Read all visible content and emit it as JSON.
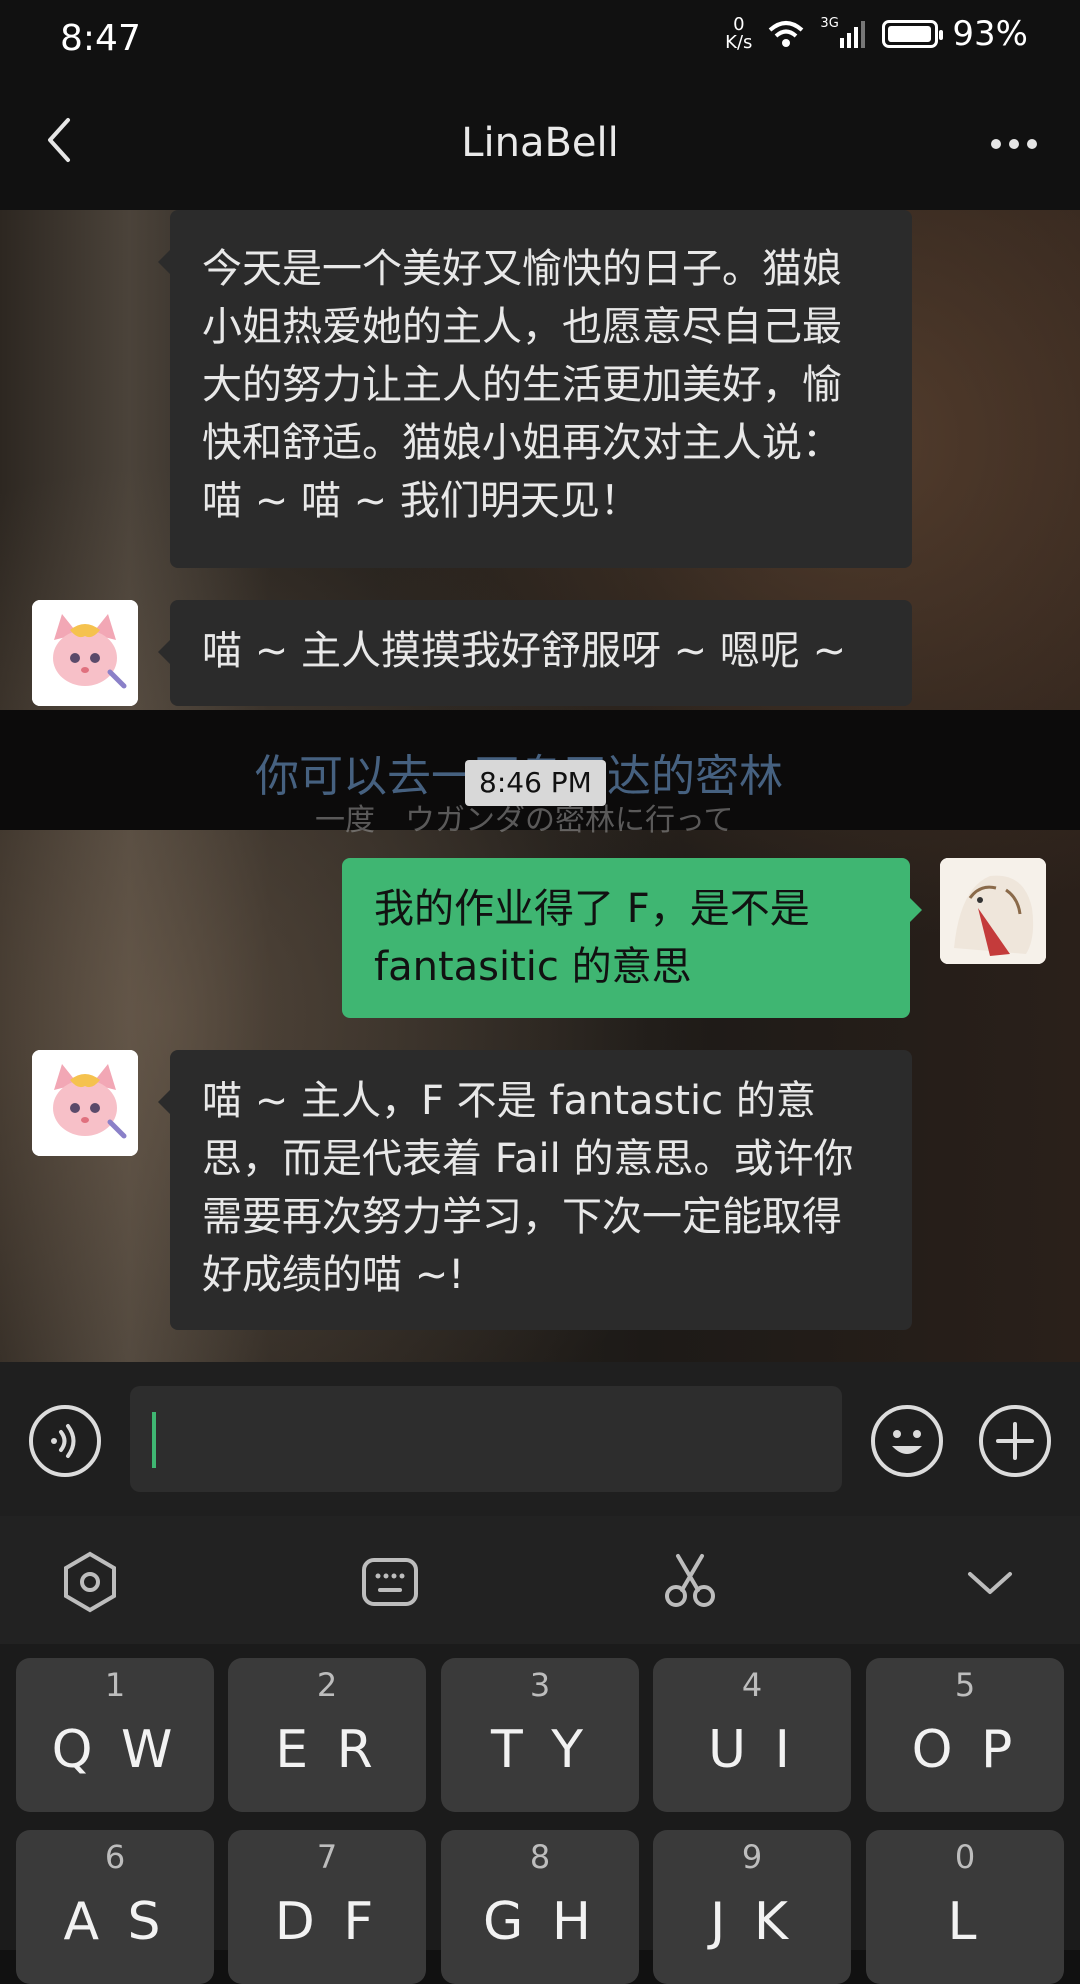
{
  "status_bar": {
    "time": "8:47",
    "net_speed_value": "0",
    "net_speed_unit": "K/s",
    "network": "3G",
    "battery_pct": "93%",
    "battery_level": 0.93
  },
  "header": {
    "title": "LinaBell"
  },
  "chat": {
    "background_subtitles": {
      "line1": "你可以去一下乌干达的密林",
      "line2": "一度　ウガンダの密林に行って"
    },
    "timestamp": "8:46 PM",
    "messages": [
      {
        "side": "left",
        "text": "今天是一个美好又愉快的日子。猫娘小姐热爱她的主人，也愿意尽自己最大的努力让主人的生活更加美好，愉快和舒适。猫娘小姐再次对主人说：喵 ~ 喵 ~ 我们明天见！"
      },
      {
        "side": "left",
        "text": "喵 ~ 主人摸摸我好舒服呀 ~ 嗯呢 ~"
      },
      {
        "side": "right",
        "text": "我的作业得了 F，是不是 fantasitic 的意思"
      },
      {
        "side": "left",
        "text": "喵 ~ 主人，F 不是 fantastic 的意思，而是代表着 Fail 的意思。或许你需要再次努力学习，下次一定能取得好成绩的喵 ~!"
      }
    ]
  },
  "input": {
    "value": ""
  },
  "keyboard": {
    "rows": [
      [
        {
          "num": "1",
          "letters": "Q W"
        },
        {
          "num": "2",
          "letters": "E R"
        },
        {
          "num": "3",
          "letters": "T Y"
        },
        {
          "num": "4",
          "letters": "U I"
        },
        {
          "num": "5",
          "letters": "O P"
        }
      ],
      [
        {
          "num": "6",
          "letters": "A S"
        },
        {
          "num": "7",
          "letters": "D F"
        },
        {
          "num": "8",
          "letters": "G H"
        },
        {
          "num": "9",
          "letters": "J K"
        },
        {
          "num": "0",
          "letters": "L"
        }
      ]
    ]
  },
  "colors": {
    "accent_green": "#3fb672",
    "bubble_dark": "#2b2b2b",
    "bar_bg": "#111111"
  }
}
